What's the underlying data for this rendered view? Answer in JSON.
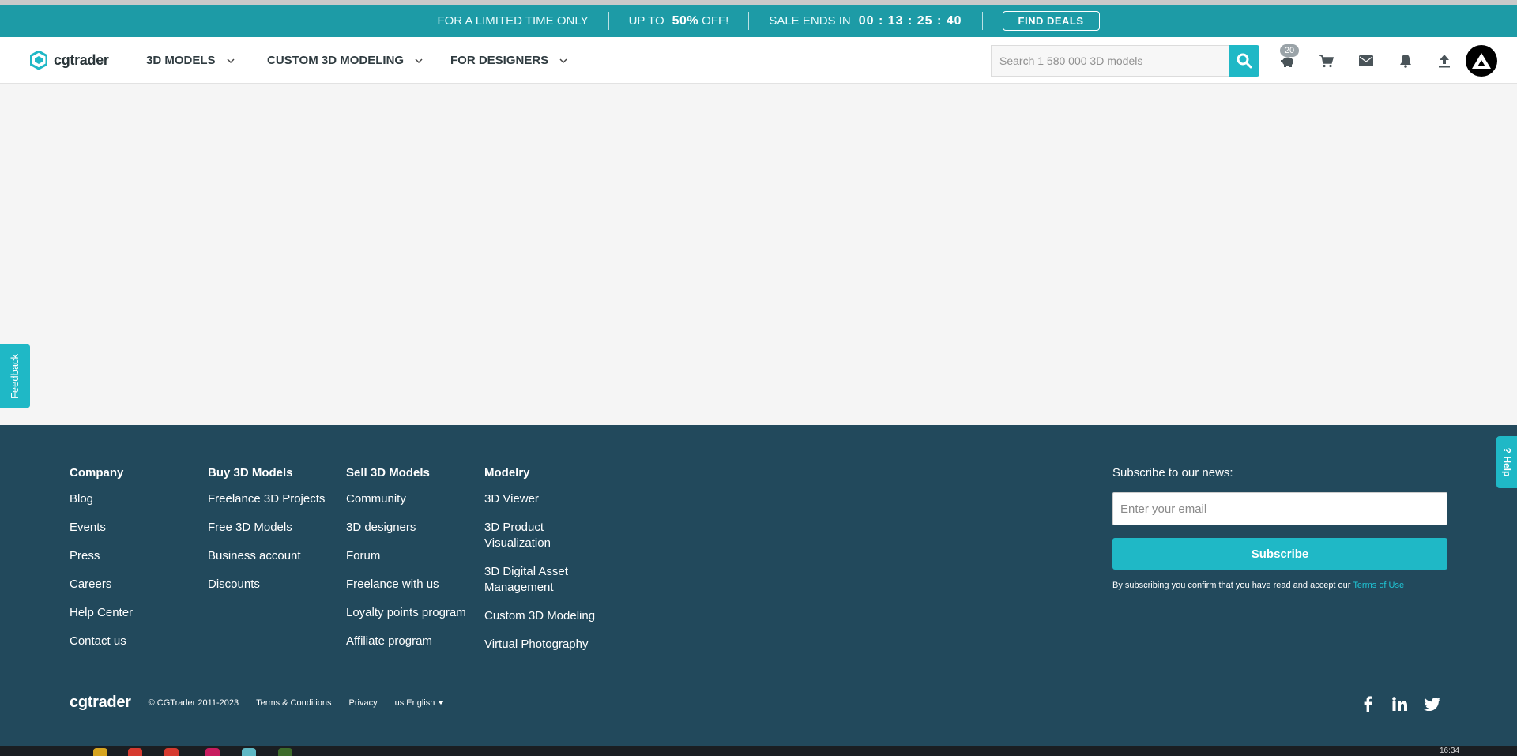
{
  "promo": {
    "limited": "FOR A LIMITED TIME ONLY",
    "up_to": "UP TO",
    "percent": "50%",
    "off": "OFF!",
    "sale_ends": "SALE ENDS IN",
    "timer": "00 : 13 : 25 : 40",
    "find_deals": "FIND DEALS"
  },
  "nav": {
    "brand": "cgtrader",
    "menu": [
      "3D MODELS",
      "CUSTOM 3D MODELING",
      "FOR DESIGNERS"
    ],
    "search_placeholder": "Search 1 580 000 3D models",
    "points_badge": "20"
  },
  "feedback_label": "Feedback",
  "help_label": "Help",
  "footer": {
    "columns": [
      {
        "title": "Company",
        "links": [
          "Blog",
          "Events",
          "Press",
          "Careers",
          "Help Center",
          "Contact us"
        ]
      },
      {
        "title": "Buy 3D Models",
        "links": [
          "Freelance 3D Projects",
          "Free 3D Models",
          "Business account",
          "Discounts"
        ]
      },
      {
        "title": "Sell 3D Models",
        "links": [
          "Community",
          "3D designers",
          "Forum",
          "Freelance with us",
          "Loyalty points program",
          "Affiliate program"
        ]
      },
      {
        "title": "Modelry",
        "links": [
          "3D Viewer",
          "3D Product Visualization",
          "3D Digital Asset Management",
          "Custom 3D Modeling",
          "Virtual Photography"
        ]
      }
    ],
    "subscribe": {
      "title": "Subscribe to our news:",
      "email_placeholder": "Enter your email",
      "button": "Subscribe",
      "legal": "By subscribing you confirm that you have read and accept our",
      "terms": "Terms of Use"
    },
    "bottom": {
      "brand": "cgtrader",
      "copyright": "© CGTrader 2011-2023",
      "terms": "Terms & Conditions",
      "privacy": "Privacy",
      "language": "us English"
    }
  },
  "taskbar": {
    "clock": "16:34"
  },
  "colors": {
    "accent": "#1fb8c6",
    "promo_bg": "#1d9ba6",
    "footer_bg": "#22495c"
  }
}
